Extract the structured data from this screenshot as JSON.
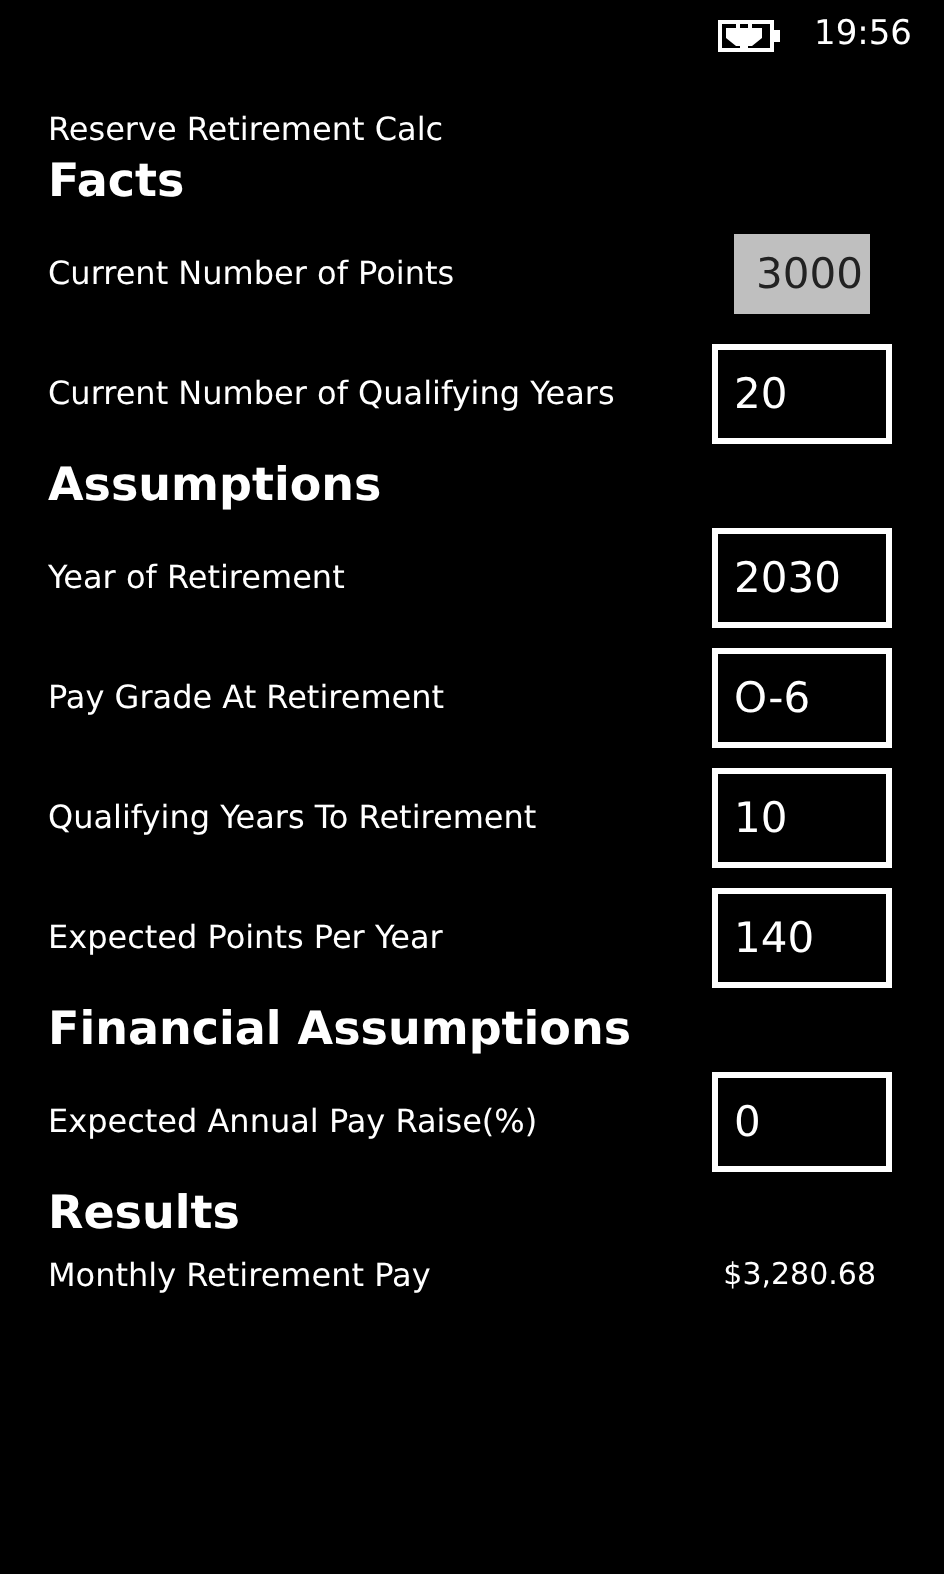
{
  "status_bar": {
    "time": "19:56"
  },
  "app_title": "Reserve Retirement Calc",
  "sections": [
    {
      "heading": "Facts",
      "rows": [
        {
          "kind": "field",
          "label": "Current Number of Points",
          "value": "3000",
          "focused": true
        },
        {
          "kind": "field",
          "label": "Current Number of Qualifying Years",
          "value": "20",
          "focused": false
        }
      ]
    },
    {
      "heading": "Assumptions",
      "rows": [
        {
          "kind": "field",
          "label": "Year of Retirement",
          "value": "2030",
          "focused": false
        },
        {
          "kind": "field",
          "label": "Pay Grade At Retirement",
          "value": "O-6",
          "focused": false
        },
        {
          "kind": "field",
          "label": "Qualifying Years To Retirement",
          "value": "10",
          "focused": false
        },
        {
          "kind": "field",
          "label": "Expected Points Per Year",
          "value": "140",
          "focused": false
        }
      ]
    },
    {
      "heading": "Financial Assumptions",
      "rows": [
        {
          "kind": "field",
          "label": "Expected Annual Pay Raise(%)",
          "value": "0",
          "focused": false
        }
      ]
    },
    {
      "heading": "Results",
      "rows": [
        {
          "kind": "result",
          "label": "Monthly Retirement Pay",
          "value": "$3,280.68"
        }
      ]
    }
  ]
}
